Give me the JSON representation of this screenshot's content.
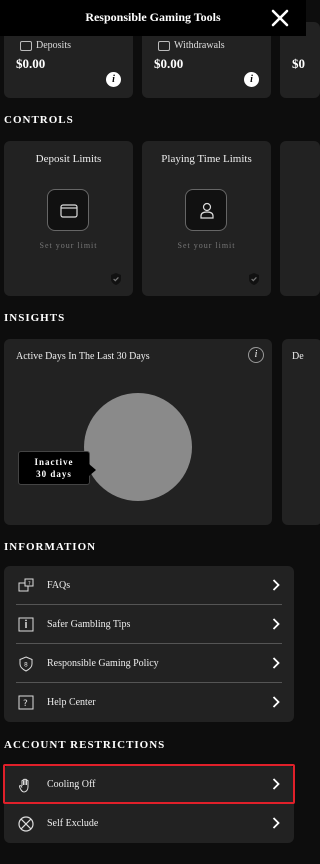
{
  "header": {
    "title": "Responsible Gaming Tools"
  },
  "stats": [
    {
      "label": "Deposits",
      "value": "$0.00",
      "info": "i"
    },
    {
      "label": "Withdrawals",
      "value": "$0.00",
      "info": "i"
    },
    {
      "label": "",
      "value": "$0",
      "info": ""
    }
  ],
  "controls": {
    "heading": "CONTROLS",
    "cards": [
      {
        "title": "Deposit Limits",
        "subtitle": "Set your limit",
        "icon": "wallet-icon"
      },
      {
        "title": "Playing Time Limits",
        "subtitle": "Set your limit",
        "icon": "person-icon"
      }
    ]
  },
  "insights": {
    "heading": "INSIGHTS",
    "card_title": "Active Days In The Last 30 Days",
    "next_card_title": "De",
    "tooltip_line1": "Inactive",
    "tooltip_line2": "30 days",
    "chart_data": {
      "type": "pie",
      "categories": [
        "Inactive"
      ],
      "values": [
        30
      ],
      "title": "Active Days In The Last 30 Days"
    }
  },
  "information": {
    "heading": "INFORMATION",
    "items": [
      {
        "label": "FAQs",
        "icon": "faq-icon"
      },
      {
        "label": "Safer Gambling Tips",
        "icon": "info-icon"
      },
      {
        "label": "Responsible Gaming Policy",
        "icon": "shield-icon"
      },
      {
        "label": "Help Center",
        "icon": "help-icon"
      }
    ]
  },
  "restrictions": {
    "heading": "ACCOUNT RESTRICTIONS",
    "items": [
      {
        "label": "Cooling Off",
        "icon": "hand-icon"
      },
      {
        "label": "Self Exclude",
        "icon": "block-icon"
      }
    ]
  },
  "colors": {
    "background": "#0d0d0d",
    "card": "#222222",
    "highlight": "#e0202a"
  }
}
